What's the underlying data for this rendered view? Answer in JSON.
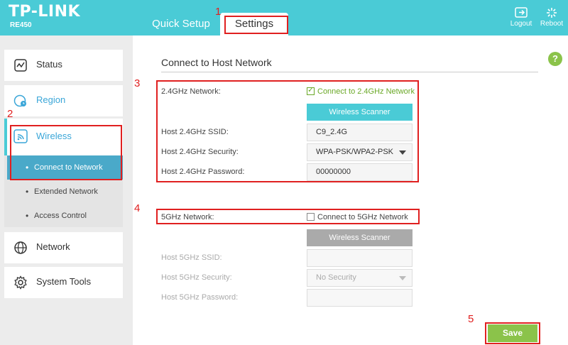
{
  "header": {
    "brand": "TP-LINK",
    "model": "RE450",
    "tabs": {
      "quick_setup": "Quick Setup",
      "settings": "Settings"
    },
    "logout": "Logout",
    "reboot": "Reboot"
  },
  "sidebar": {
    "status": "Status",
    "region": "Region",
    "wireless": "Wireless",
    "wireless_sub": {
      "connect": "Connect to Network",
      "extended": "Extended Network",
      "access": "Access Control"
    },
    "network": "Network",
    "system_tools": "System Tools"
  },
  "main": {
    "title": "Connect to Host Network",
    "help": "?",
    "band24": {
      "label": "2.4GHz Network:",
      "checkbox": "Connect to 2.4GHz Network",
      "checked": true,
      "scanner": "Wireless Scanner",
      "ssid_label": "Host 2.4GHz SSID:",
      "ssid": "C9_2.4G",
      "security_label": "Host 2.4GHz Security:",
      "security": "WPA-PSK/WPA2-PSK",
      "password_label": "Host 2.4GHz Password:",
      "password": "00000000"
    },
    "band5": {
      "label": "5GHz Network:",
      "checkbox": "Connect to 5GHz Network",
      "checked": false,
      "scanner": "Wireless Scanner",
      "ssid_label": "Host 5GHz SSID:",
      "ssid": "",
      "security_label": "Host 5GHz Security:",
      "security": "No Security",
      "password_label": "Host 5GHz Password:",
      "password": ""
    },
    "save": "Save"
  },
  "annotations": [
    "1",
    "2",
    "3",
    "4",
    "5"
  ],
  "colors": {
    "accent": "#4acbd6",
    "highlight": "#e02020",
    "save": "#8bc34a"
  }
}
